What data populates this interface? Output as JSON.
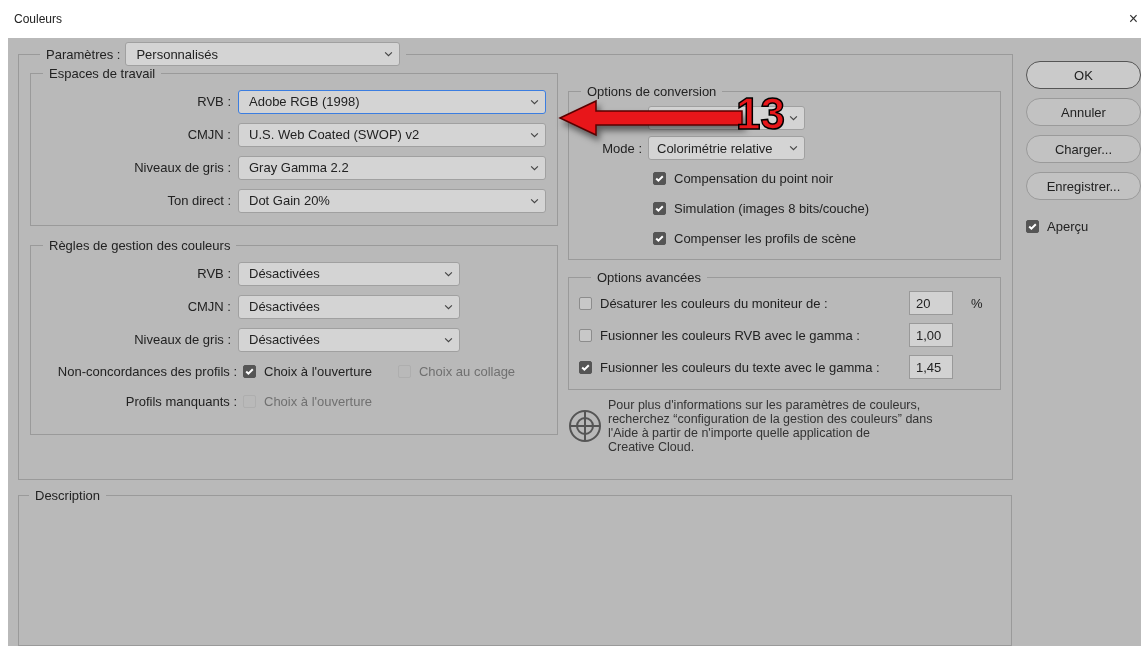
{
  "window": {
    "title": "Couleurs",
    "close": "×"
  },
  "settings": {
    "label": "Paramètres :",
    "value": "Personnalisés"
  },
  "working_spaces": {
    "title": "Espaces de travail",
    "rows": [
      {
        "label": "RVB :",
        "value": "Adobe RGB (1998)",
        "focused": true
      },
      {
        "label": "CMJN :",
        "value": "U.S. Web Coated (SWOP) v2",
        "focused": false
      },
      {
        "label": "Niveaux de gris :",
        "value": "Gray Gamma 2.2",
        "focused": false
      },
      {
        "label": "Ton direct :",
        "value": "Dot Gain 20%",
        "focused": false
      }
    ]
  },
  "policies": {
    "title": "Règles de gestion des couleurs",
    "rows": [
      {
        "label": "RVB :",
        "value": "Désactivées"
      },
      {
        "label": "CMJN :",
        "value": "Désactivées"
      },
      {
        "label": "Niveaux de gris :",
        "value": "Désactivées"
      }
    ],
    "checks": [
      {
        "label": "Non-concordances des profils :",
        "options": [
          {
            "label": "Choix à l'ouverture",
            "checked": true,
            "disabled": false
          },
          {
            "label": "Choix au collage",
            "checked": false,
            "disabled": true
          }
        ]
      },
      {
        "label": "Profils manquants :",
        "options": [
          {
            "label": "Choix à l'ouverture",
            "checked": false,
            "disabled": true
          }
        ]
      }
    ]
  },
  "conversion": {
    "title": "Options de conversion",
    "mode": {
      "label": "Mode :",
      "value": "Colorimétrie relative"
    },
    "options": [
      {
        "label": "Compensation du point noir",
        "checked": true
      },
      {
        "label": "Simulation (images 8 bits/couche)",
        "checked": true
      },
      {
        "label": "Compenser les profils de scène",
        "checked": true
      }
    ]
  },
  "advanced": {
    "title": "Options avancées",
    "rows": [
      {
        "label": "Désaturer les couleurs du moniteur de :",
        "checked": false,
        "value": "20",
        "unit": "%"
      },
      {
        "label": "Fusionner les couleurs RVB avec le gamma :",
        "checked": false,
        "value": "1,00"
      },
      {
        "label": "Fusionner les couleurs du texte avec le gamma :",
        "checked": true,
        "value": "1,45"
      }
    ]
  },
  "info": "Pour plus d'informations sur les paramètres de couleurs,\nrecherchez “configuration de la gestion des couleurs” dans\nl'Aide à partir de n'importe quelle application de\nCreative Cloud.",
  "description": {
    "title": "Description"
  },
  "buttons": [
    {
      "label": "OK",
      "default": true
    },
    {
      "label": "Annuler",
      "default": false
    },
    {
      "label": "Charger...",
      "default": false
    },
    {
      "label": "Enregistrer...",
      "default": false
    }
  ],
  "preview": {
    "label": "Aperçu",
    "checked": true
  },
  "annotation": {
    "label": "13"
  }
}
